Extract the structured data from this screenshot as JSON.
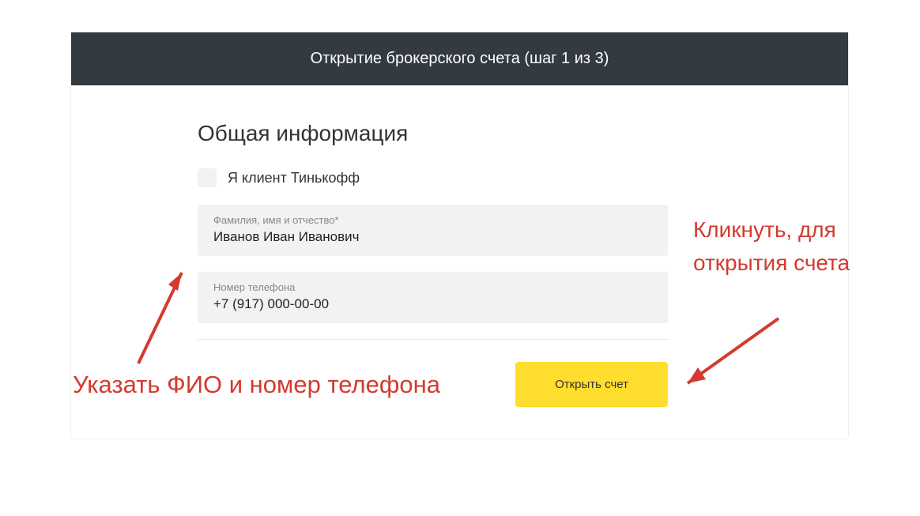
{
  "header": {
    "title": "Открытие брокерского счета (шаг 1 из 3)"
  },
  "form": {
    "section_title": "Общая информация",
    "checkbox_label": "Я клиент Тинькофф",
    "fields": {
      "fullname": {
        "label": "Фамилия, имя и отчество*",
        "value": "Иванов Иван Иванович"
      },
      "phone": {
        "label": "Номер телефона",
        "value": "+7 (917) 000-00-00"
      }
    },
    "submit_label": "Открыть счет"
  },
  "annotations": {
    "left": "Указать ФИО и номер телефона",
    "right": "Кликнуть, для открытия счета"
  },
  "colors": {
    "header_bg": "#333a41",
    "accent": "#ffdd2d",
    "annotation": "#d43a2f"
  }
}
